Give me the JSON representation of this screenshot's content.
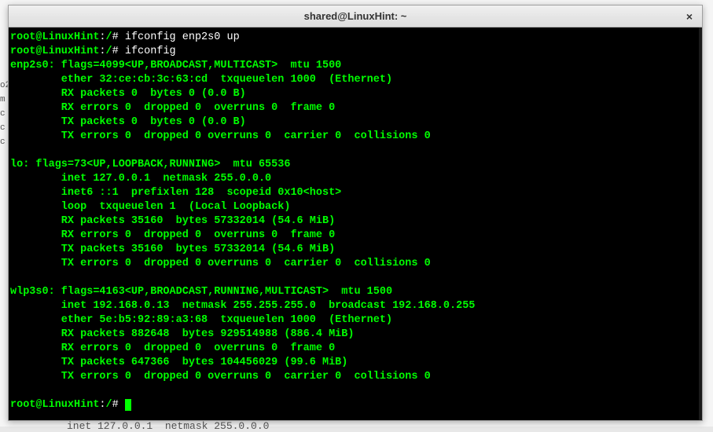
{
  "window": {
    "title": "shared@LinuxHint: ~",
    "closeLabel": "×"
  },
  "bgLeft": [
    "o2",
    "m",
    "c",
    "c",
    "c"
  ],
  "bgShadow": "inet 127.0.0.1  netmask 255.0.0.0",
  "term": {
    "p1_user": "root@LinuxHint",
    "p1_colon": ":",
    "p1_path": "/",
    "p1_hash": "# ",
    "p1_cmd": "ifconfig enp2s0 up",
    "p2_user": "root@LinuxHint",
    "p2_colon": ":",
    "p2_path": "/",
    "p2_hash": "# ",
    "p2_cmd": "ifconfig",
    "iface1_head": "enp2s0: flags=4099<UP,BROADCAST,MULTICAST>  mtu 1500",
    "iface1_l1": "        ether 32:ce:cb:3c:63:cd  txqueuelen 1000  (Ethernet)",
    "iface1_l2": "        RX packets 0  bytes 0 (0.0 B)",
    "iface1_l3": "        RX errors 0  dropped 0  overruns 0  frame 0",
    "iface1_l4": "        TX packets 0  bytes 0 (0.0 B)",
    "iface1_l5": "        TX errors 0  dropped 0 overruns 0  carrier 0  collisions 0",
    "blank1": "",
    "iface2_head": "lo: flags=73<UP,LOOPBACK,RUNNING>  mtu 65536",
    "iface2_l1": "        inet 127.0.0.1  netmask 255.0.0.0",
    "iface2_l2": "        inet6 ::1  prefixlen 128  scopeid 0x10<host>",
    "iface2_l3": "        loop  txqueuelen 1  (Local Loopback)",
    "iface2_l4": "        RX packets 35160  bytes 57332014 (54.6 MiB)",
    "iface2_l5": "        RX errors 0  dropped 0  overruns 0  frame 0",
    "iface2_l6": "        TX packets 35160  bytes 57332014 (54.6 MiB)",
    "iface2_l7": "        TX errors 0  dropped 0 overruns 0  carrier 0  collisions 0",
    "blank2": "",
    "iface3_head": "wlp3s0: flags=4163<UP,BROADCAST,RUNNING,MULTICAST>  mtu 1500",
    "iface3_l1": "        inet 192.168.0.13  netmask 255.255.255.0  broadcast 192.168.0.255",
    "iface3_l2": "        ether 5e:b5:92:89:a3:68  txqueuelen 1000  (Ethernet)",
    "iface3_l3": "        RX packets 882648  bytes 929514988 (886.4 MiB)",
    "iface3_l4": "        RX errors 0  dropped 0  overruns 0  frame 0",
    "iface3_l5": "        TX packets 647366  bytes 104456029 (99.6 MiB)",
    "iface3_l6": "        TX errors 0  dropped 0 overruns 0  carrier 0  collisions 0",
    "blank3": "",
    "p3_user": "root@LinuxHint",
    "p3_colon": ":",
    "p3_path": "/",
    "p3_hash": "# "
  }
}
